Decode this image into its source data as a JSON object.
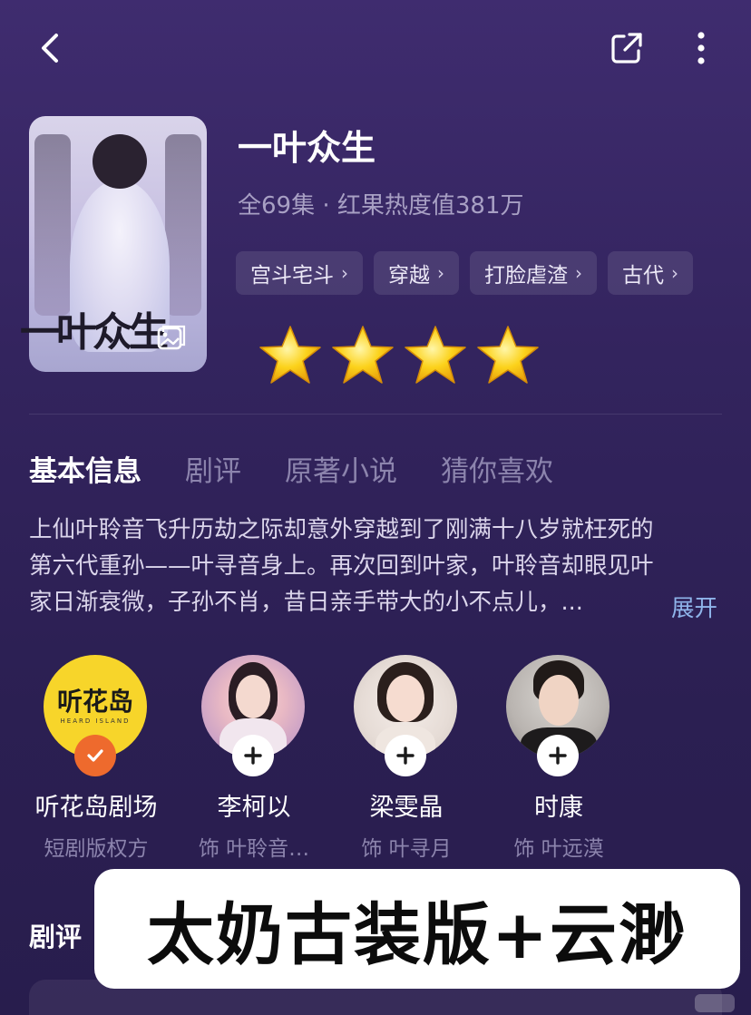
{
  "show": {
    "title": "一叶众生",
    "meta": "全69集 · 红果热度值381万",
    "tags": [
      {
        "label": "宫斗宅斗"
      },
      {
        "label": "穿越"
      },
      {
        "label": "打脸虐渣"
      },
      {
        "label": "古代"
      }
    ],
    "rating_stars": 4,
    "poster_title": "一叶众生"
  },
  "tabs": [
    {
      "label": "基本信息",
      "active": true
    },
    {
      "label": "剧评"
    },
    {
      "label": "原著小说"
    },
    {
      "label": "猜你喜欢"
    }
  ],
  "synopsis": {
    "lines": [
      "上仙叶聆音飞升历劫之际却意外穿越到了刚满十八岁就枉死的",
      "第六代重孙——叶寻音身上。再次回到叶家，叶聆音却眼见叶",
      "家日渐衰微，子孙不肖，昔日亲手带大的小不点儿，..."
    ],
    "expand_label": "展开"
  },
  "cast": [
    {
      "name": "听花岛剧场",
      "role": "短剧版权方",
      "logo_text": "听花岛",
      "logo_sub": "HEARD ISLAND",
      "badge": "check"
    },
    {
      "name": "李柯以",
      "role": "饰 叶聆音…",
      "badge": "plus"
    },
    {
      "name": "梁雯晶",
      "role": "饰 叶寻月",
      "badge": "plus"
    },
    {
      "name": "时康",
      "role": "饰 叶远漠",
      "badge": "plus"
    }
  ],
  "review_section_label": "剧评",
  "overlay_caption": "太奶古装版+云渺",
  "colors": {
    "background": "#33245e",
    "accent_link": "#8fb4ea",
    "badge_orange": "#ee6a2d",
    "logo_yellow": "#f7d52a"
  }
}
